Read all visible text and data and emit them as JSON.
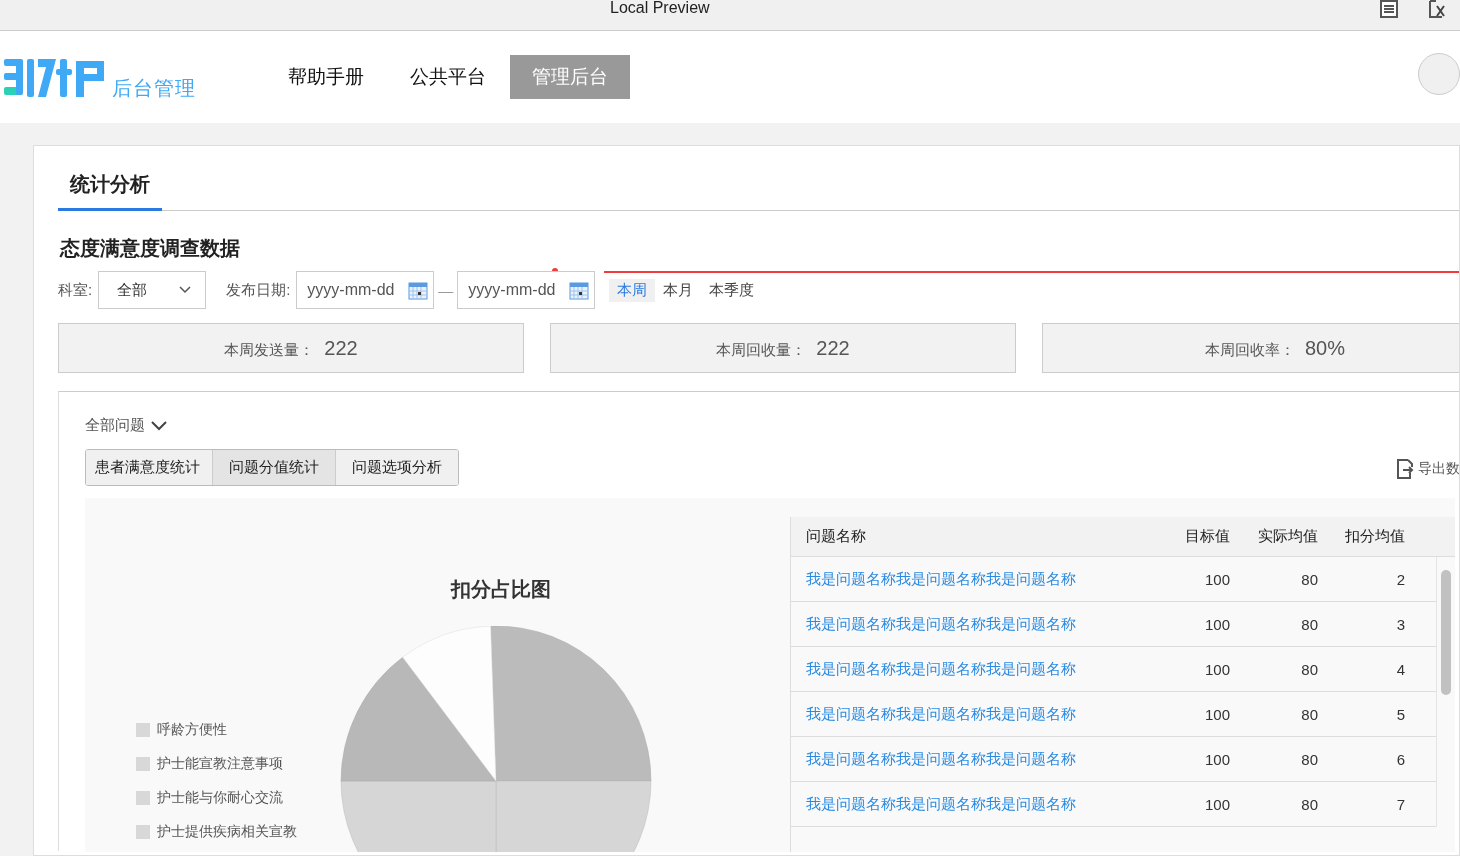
{
  "window": {
    "title": "Local Preview"
  },
  "nav": {
    "brand": "后台管理",
    "items": [
      {
        "label": "帮助手册",
        "selected": false
      },
      {
        "label": "公共平台",
        "selected": false
      },
      {
        "label": "管理后台",
        "selected": true
      }
    ]
  },
  "page_tabs": [
    {
      "label": "统计分析",
      "selected": true
    }
  ],
  "section_title": "态度满意度调查数据",
  "filters": {
    "department": {
      "label": "科室:",
      "value": "全部"
    },
    "date": {
      "label": "发布日期:",
      "start_placeholder": "yyyy-mm-dd",
      "separator": "—",
      "end_placeholder": "yyyy-mm-dd"
    },
    "ranges": [
      {
        "label": "本周",
        "selected": true
      },
      {
        "label": "本月",
        "selected": false
      },
      {
        "label": "本季度",
        "selected": false
      }
    ]
  },
  "stats": [
    {
      "label": "本周发送量：",
      "value": "222"
    },
    {
      "label": "本周回收量：",
      "value": "222"
    },
    {
      "label": "本周回收率：",
      "value": "80%"
    }
  ],
  "question_filter": "全部问题",
  "view_tabs": [
    {
      "label": "患者满意度统计",
      "selected": false
    },
    {
      "label": "问题分值统计",
      "selected": true
    },
    {
      "label": "问题选项分析",
      "selected": false
    }
  ],
  "export_label": "导出数",
  "chart": {
    "title": "扣分占比图",
    "legend": [
      "呼龄方便性",
      "护士能宣教注意事项",
      "护士能与你耐心交流",
      "护士提供疾病相关宣教"
    ]
  },
  "table": {
    "columns": [
      "问题名称",
      "目标值",
      "实际均值",
      "扣分均值"
    ],
    "rows": [
      [
        "我是问题名称我是问题名称我是问题名称",
        "100",
        "80",
        "2"
      ],
      [
        "我是问题名称我是问题名称我是问题名称",
        "100",
        "80",
        "3"
      ],
      [
        "我是问题名称我是问题名称我是问题名称",
        "100",
        "80",
        "4"
      ],
      [
        "我是问题名称我是问题名称我是问题名称",
        "100",
        "80",
        "5"
      ],
      [
        "我是问题名称我是问题名称我是问题名称",
        "100",
        "80",
        "6"
      ],
      [
        "我是问题名称我是问题名称我是问题名称",
        "100",
        "80",
        "7"
      ]
    ]
  }
}
